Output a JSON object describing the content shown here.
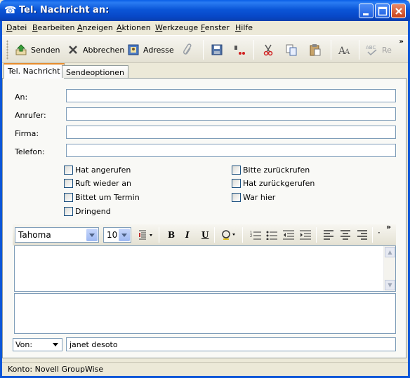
{
  "window": {
    "title": "Tel. Nachricht an:"
  },
  "menu": [
    "Datei",
    "Bearbeiten",
    "Anzeigen",
    "Aktionen",
    "Werkzeuge",
    "Fenster",
    "Hilfe"
  ],
  "toolbar": {
    "send": "Senden",
    "cancel": "Abbrechen",
    "address": "Adresse",
    "spell": "Re"
  },
  "tabs": [
    "Tel. Nachricht",
    "Sendeoptionen"
  ],
  "fields": {
    "to": {
      "label": "An:",
      "value": ""
    },
    "caller": {
      "label": "Anrufer:",
      "value": ""
    },
    "company": {
      "label": "Firma:",
      "value": ""
    },
    "phone": {
      "label": "Telefon:",
      "value": ""
    }
  },
  "checkboxes": {
    "called": "Hat angerufen",
    "will_call_again": "Ruft wieder an",
    "asks_appointment": "Bittet um Termin",
    "urgent": "Dringend",
    "please_call_back": "Bitte zurückrufen",
    "returned_call": "Hat zurückgerufen",
    "was_here": "War hier"
  },
  "format": {
    "font": "Tahoma",
    "size": "10"
  },
  "from": {
    "label": "Von:",
    "value": "janet desoto"
  },
  "status": "Konto: Novell GroupWise"
}
